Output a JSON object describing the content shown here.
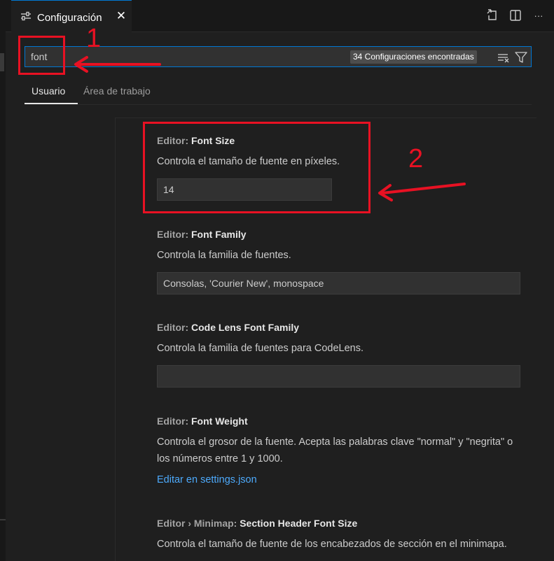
{
  "tab": {
    "title": "Configuración",
    "icon": "settings-sliders-icon",
    "close_glyph": "✕"
  },
  "toolbar": {
    "open_json_icon": "open-settings-json-icon",
    "split_icon": "split-editor-icon",
    "more_glyph": "···"
  },
  "search": {
    "value": "font",
    "results_badge": "34 Configuraciones encontradas"
  },
  "scopes": [
    {
      "label": "Usuario",
      "active": true
    },
    {
      "label": "Área de trabajo",
      "active": false
    }
  ],
  "settings": [
    {
      "category": "Editor: ",
      "name": "Font Size",
      "description": "Controla el tamaño de fuente en píxeles.",
      "value": "14"
    },
    {
      "category": "Editor: ",
      "name": "Font Family",
      "description": "Controla la familia de fuentes.",
      "value": "Consolas, 'Courier New', monospace"
    },
    {
      "category": "Editor: ",
      "name": "Code Lens Font Family",
      "description": "Controla la familia de fuentes para CodeLens.",
      "value": ""
    },
    {
      "category": "Editor: ",
      "name": "Font Weight",
      "description": "Controla el grosor de la fuente. Acepta las palabras clave \"normal\" y \"negrita\" o los números entre 1 y 1000.",
      "link": "Editar en settings.json"
    },
    {
      "category": "Editor › Minimap: ",
      "name": "Section Header Font Size",
      "description": "Controla el tamaño de fuente de los encabezados de sección en el minimapa."
    }
  ],
  "annotations": {
    "label_1": "1",
    "label_2": "2",
    "color": "#e81123"
  },
  "colors": {
    "accent": "#0078d4",
    "link": "#4daafc",
    "background": "#1f1f1f"
  }
}
